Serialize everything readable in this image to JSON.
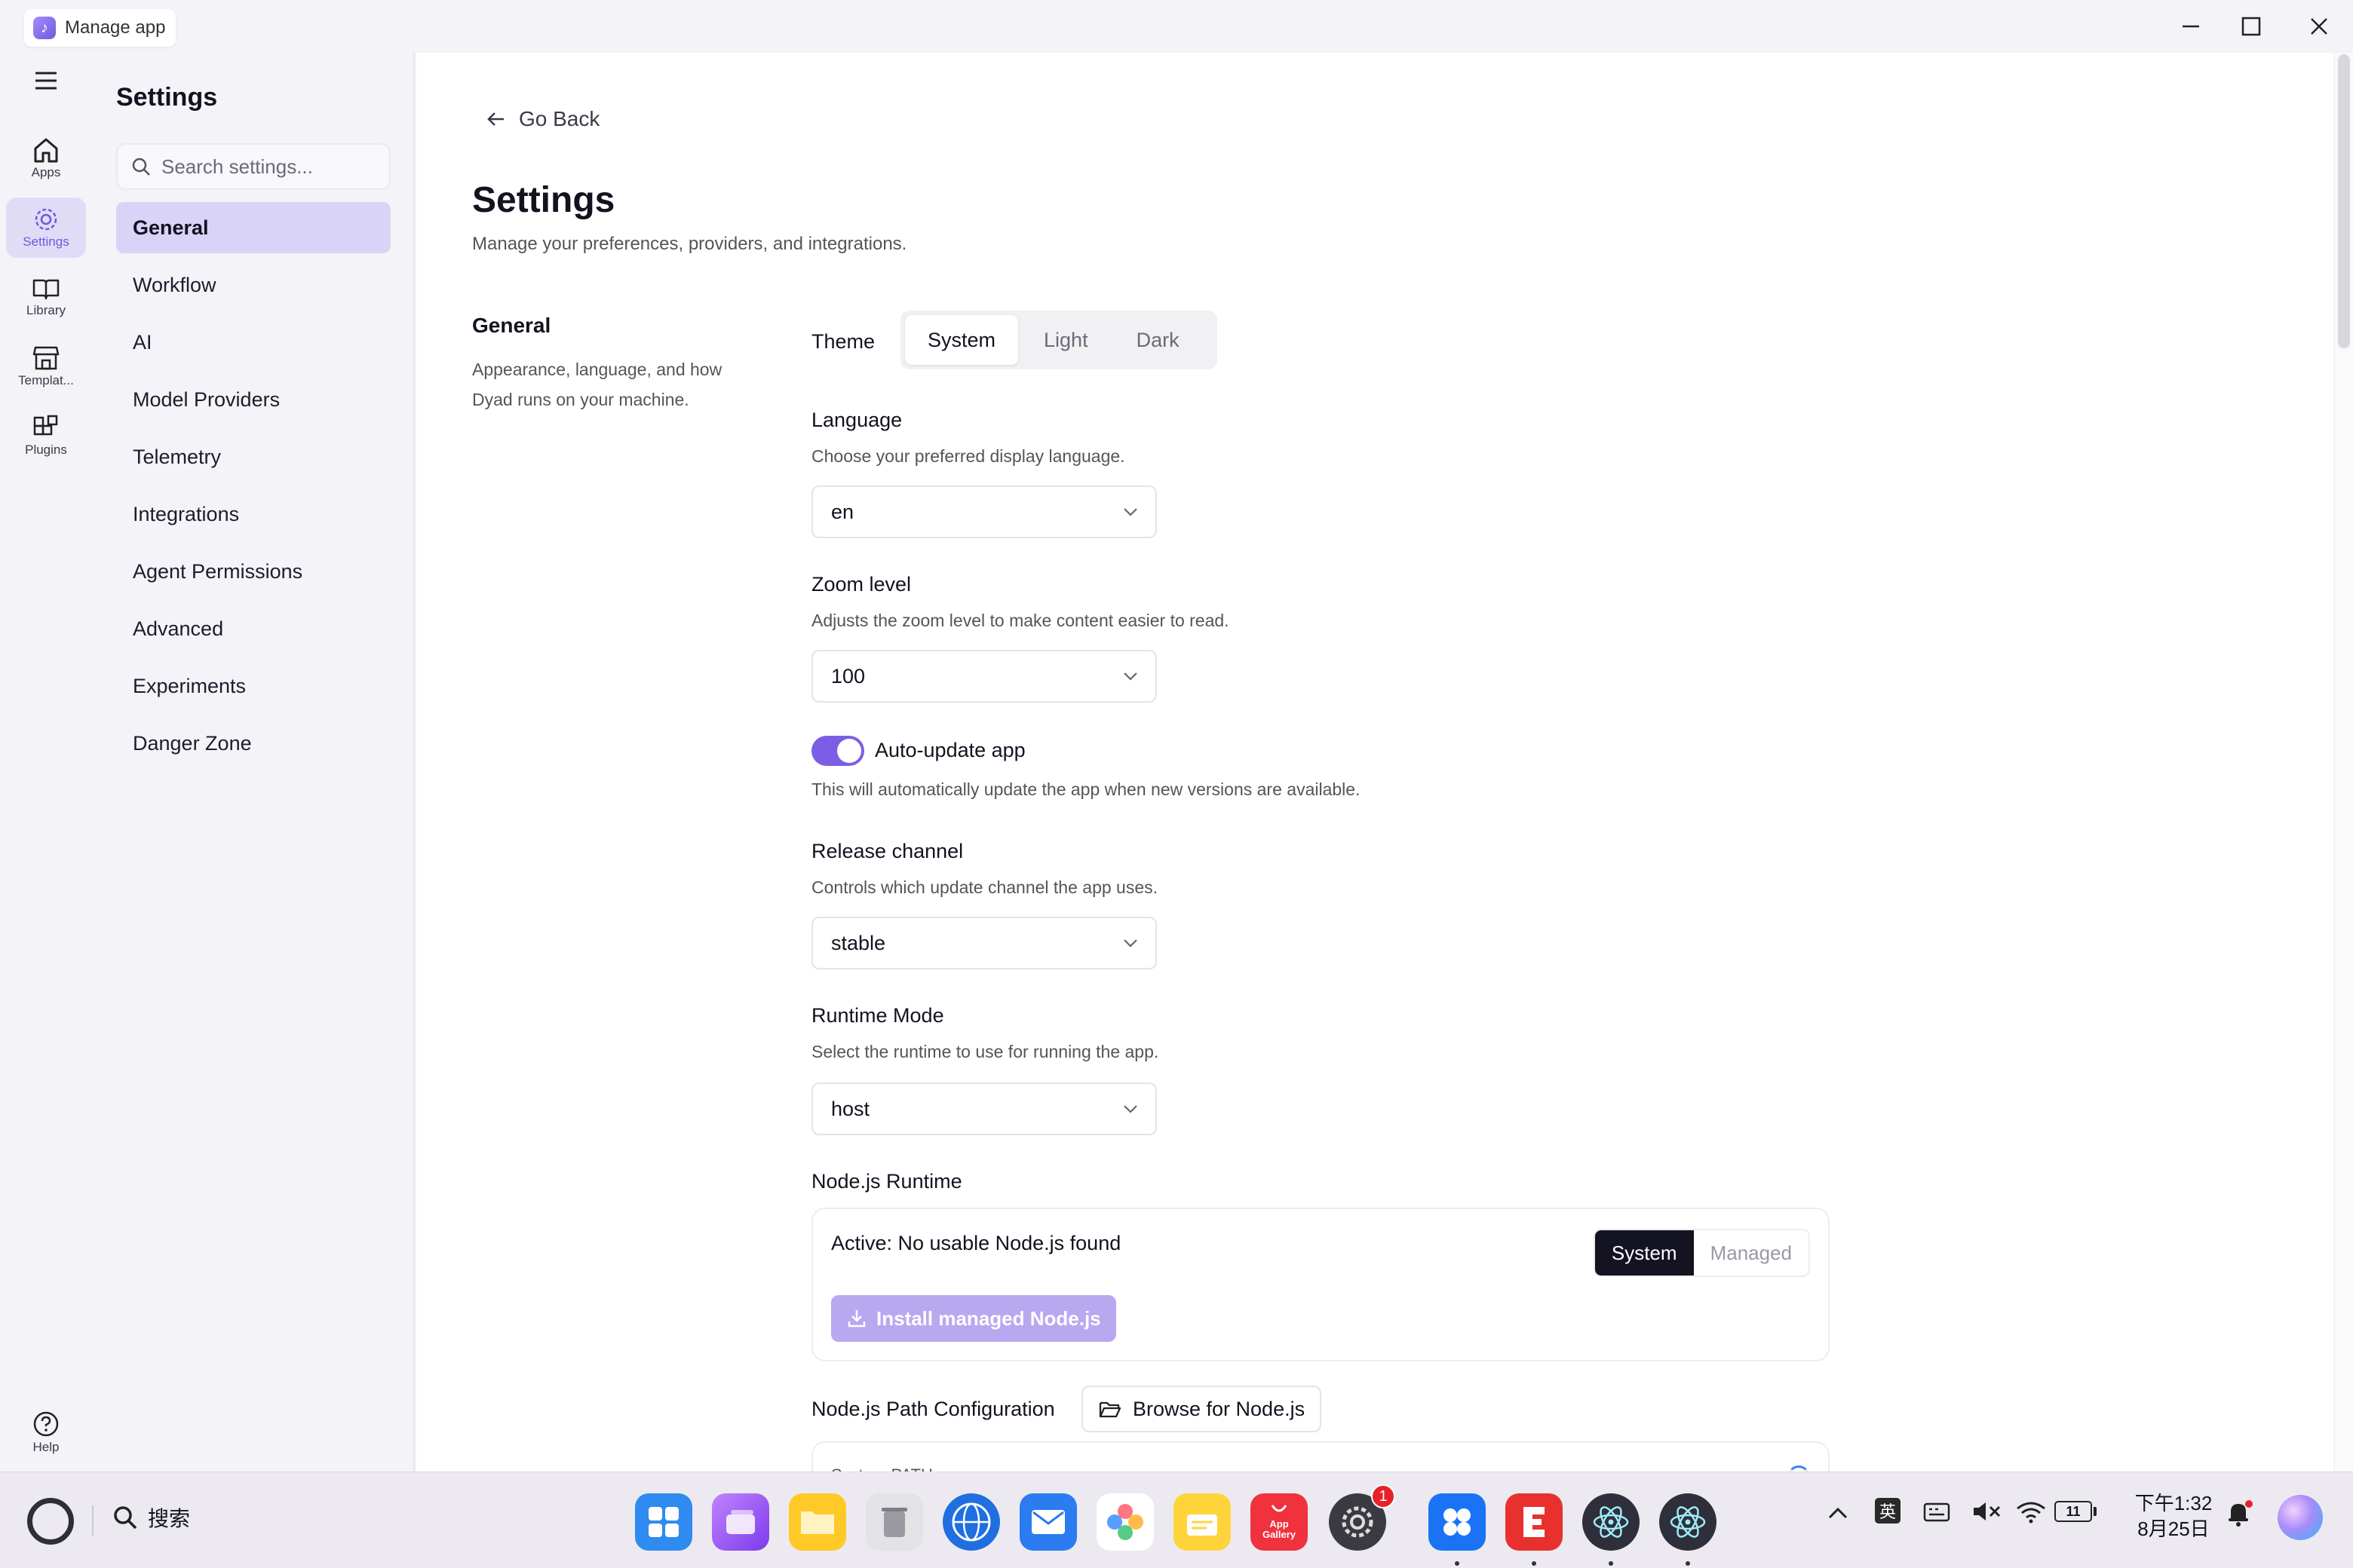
{
  "titlebar": {
    "app_name": "Manage app"
  },
  "rail": {
    "apps": "Apps",
    "settings": "Settings",
    "library": "Library",
    "templates": "Templat...",
    "plugins": "Plugins",
    "help": "Help"
  },
  "settings_nav": {
    "title": "Settings",
    "search_placeholder": "Search settings...",
    "items": [
      {
        "label": "General"
      },
      {
        "label": "Workflow"
      },
      {
        "label": "AI"
      },
      {
        "label": "Model Providers"
      },
      {
        "label": "Telemetry"
      },
      {
        "label": "Integrations"
      },
      {
        "label": "Agent Permissions"
      },
      {
        "label": "Advanced"
      },
      {
        "label": "Experiments"
      },
      {
        "label": "Danger Zone"
      }
    ],
    "active_index": 0
  },
  "main": {
    "go_back": "Go Back",
    "title": "Settings",
    "subtitle": "Manage your preferences, providers, and integrations.",
    "section_title": "General",
    "section_desc": "Appearance, language, and how Dyad runs on your machine.",
    "theme": {
      "label": "Theme",
      "options": [
        "System",
        "Light",
        "Dark"
      ],
      "selected": "System"
    },
    "language": {
      "label": "Language",
      "desc": "Choose your preferred display language.",
      "value": "en"
    },
    "zoom": {
      "label": "Zoom level",
      "desc": "Adjusts the zoom level to make content easier to read.",
      "value": "100"
    },
    "auto_update": {
      "label": "Auto-update app",
      "desc": "This will automatically update the app when new versions are available.",
      "enabled": true
    },
    "release_channel": {
      "label": "Release channel",
      "desc": "Controls which update channel the app uses.",
      "value": "stable"
    },
    "runtime_mode": {
      "label": "Runtime Mode",
      "desc": "Select the runtime to use for running the app.",
      "value": "host"
    },
    "node_runtime": {
      "label": "Node.js Runtime",
      "active_text": "Active: No usable Node.js found",
      "options": [
        "System",
        "Managed"
      ],
      "selected": "System",
      "install_label": "Install managed Node.js"
    },
    "node_path": {
      "label": "Node.js Path Configuration",
      "browse_label": "Browse for Node.js",
      "system_path_label": "System PATH:"
    }
  },
  "taskbar": {
    "search_label": "搜索",
    "app_gallery_label": "App Gallery",
    "settings_badge": "1",
    "ime_label": "英",
    "battery_label": "11",
    "time": "下午1:32",
    "date": "8月25日"
  },
  "colors": {
    "accent": "#7c5ee6",
    "active_nav": "#d9d3f8",
    "install_button": "#b8a8f0"
  }
}
